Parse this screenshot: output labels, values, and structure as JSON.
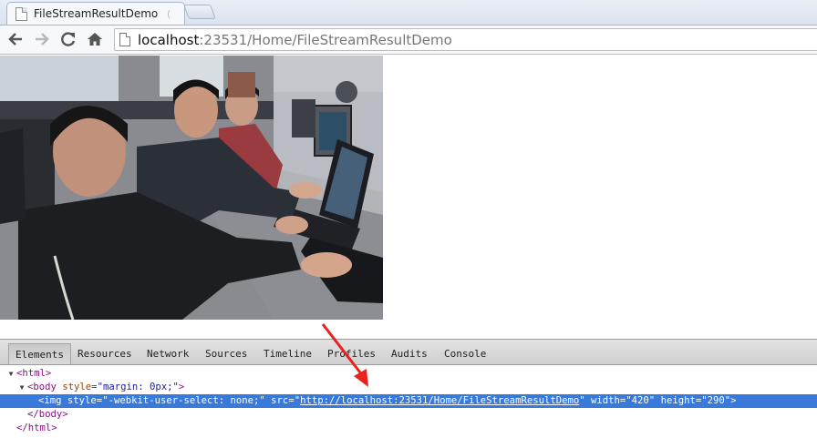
{
  "browser": {
    "tab": {
      "title": "FileStreamResultDemo",
      "close_glyph": "("
    },
    "address_bar": {
      "host": "localhost",
      "rest": ":23531/Home/FileStreamResultDemo"
    }
  },
  "page": {
    "image": {
      "alt": "Photo of three men sitting at computers in an office"
    }
  },
  "devtools": {
    "tabs": [
      "Elements",
      "Resources",
      "Network",
      "Sources",
      "Timeline",
      "Profiles",
      "Audits",
      "Console"
    ],
    "active_tab": "Elements",
    "dom": {
      "html_open": "<html>",
      "body_tag": "<body",
      "body_attr": "style",
      "body_val": "\"margin: 0px;\"",
      "body_close": ">",
      "img_tag": "<img",
      "img_style_attr": "style",
      "img_style_val": "\"-webkit-user-select: none;\"",
      "img_src_attr": "src",
      "img_src_val": "http://localhost:23531/Home/FileStreamResultDemo",
      "img_width_attr": "width",
      "img_width_val": "\"420\"",
      "img_height_attr": "height",
      "img_height_val": "\"290\"",
      "img_close": ">",
      "body_end": "</body>",
      "html_end": "</html>"
    }
  },
  "colors": {
    "selection": "#3879d9",
    "annotation_arrow": "#e8231f",
    "tag": "#881280",
    "attr": "#994500",
    "value": "#1a1aa6"
  },
  "icons": [
    "back-arrow-icon",
    "forward-arrow-icon",
    "reload-icon",
    "home-icon",
    "page-icon",
    "favicon-icon"
  ]
}
